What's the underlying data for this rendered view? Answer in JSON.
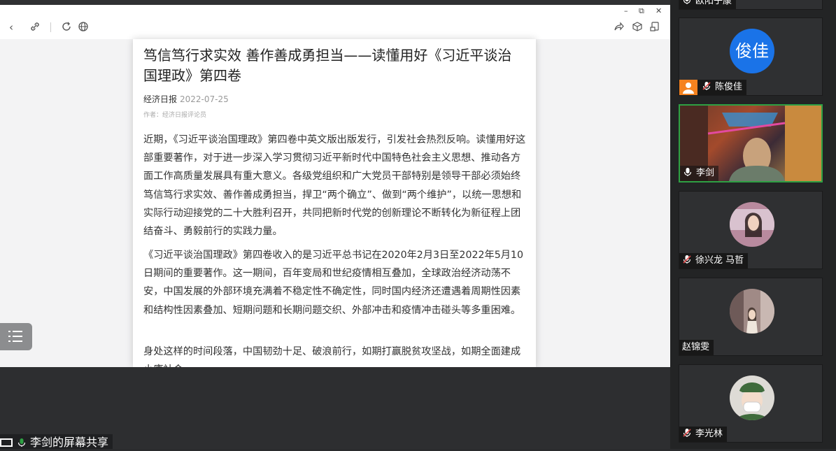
{
  "browser": {
    "window_controls": [
      "–",
      "⧉",
      "✕"
    ]
  },
  "article": {
    "title": "笃信笃行求实效 善作善成勇担当——读懂用好《习近平谈治国理政》第四卷",
    "source": "经济日报",
    "date": "2022-07-25",
    "author": "作者：经济日报评论员",
    "paragraphs": [
      "近期，《习近平谈治国理政》第四卷中英文版出版发行，引发社会热烈反响。读懂用好这部重要著作，对于进一步深入学习贯彻习近平新时代中国特色社会主义思想、推动各方面工作高质量发展具有重大意义。各级党组织和广大党员干部特别是领导干部必须始终笃信笃行求实效、善作善成勇担当，捍卫“两个确立”、做到“两个维护”，以统一思想和实际行动迎接党的二十大胜利召开，共同把新时代党的创新理论不断转化为新征程上团结奋斗、勇毅前行的实践力量。",
      "《习近平谈治国理政》第四卷收入的是习近平总书记在2020年2月3日至2022年5月10日期间的重要著作。这一期间，百年变局和世纪疫情相互叠加，全球政治经济动荡不安，中国发展的外部环境充满着不稳定性不确定性，同时国内经济还遭遇着周期性因素和结构性因素叠加、短期问题和长期问题交织、外部冲击和疫情冲击碰头等多重困难。",
      "身处这样的时间段落，中国韧劲十足、破浪前行，如期打赢脱贫攻坚战，如期全面建成小康社会"
    ]
  },
  "share": {
    "label": "李剑的屏幕共享"
  },
  "participants": [
    {
      "name": "欧阳子康",
      "avatar_text": "",
      "muted": false,
      "host": false
    },
    {
      "name": "陈俊佳",
      "avatar_text": "俊佳",
      "muted": true,
      "host": true
    },
    {
      "name": "李剑",
      "avatar_text": "",
      "muted": false,
      "host": false,
      "speaking": true
    },
    {
      "name": "徐兴龙 马哲",
      "avatar_text": "",
      "muted": true,
      "host": false
    },
    {
      "name": "赵锦雯",
      "avatar_text": "",
      "muted": false,
      "host": false
    },
    {
      "name": "李光林",
      "avatar_text": "",
      "muted": true,
      "host": false
    }
  ],
  "colors": {
    "accent_blue": "#1a73e8",
    "speaking_border": "#2ea043",
    "host_badge": "#f5821f",
    "mute_red": "#e04848"
  }
}
